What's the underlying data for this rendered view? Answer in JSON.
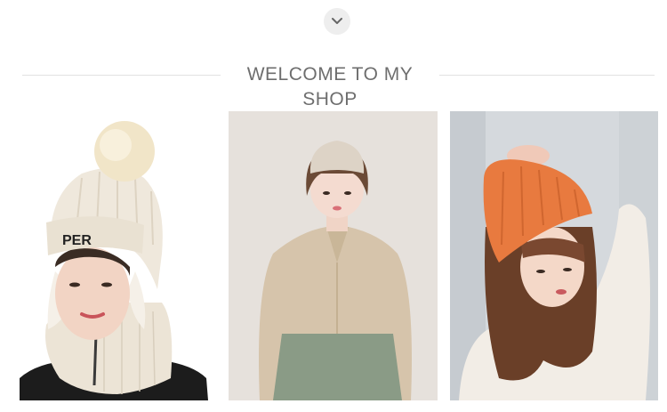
{
  "header": {
    "scroll_icon": "chevron-down-icon",
    "title": "WELCOME TO MY SHOP"
  },
  "products": [
    {
      "image": "model-cream-pompom-ski-hat-with-neck-warmer",
      "hat_text": "PER",
      "hat_color": "#efe8dc"
    },
    {
      "image": "model-beige-knit-beanie-and-shirt",
      "hat_color": "#ddd3c6"
    },
    {
      "image": "model-orange-knit-beanie",
      "hat_color": "#e87a3f"
    }
  ],
  "colors": {
    "title": "#6e6e6e",
    "rule": "#e2e2e2",
    "chevron_bg": "#eeeeee"
  }
}
